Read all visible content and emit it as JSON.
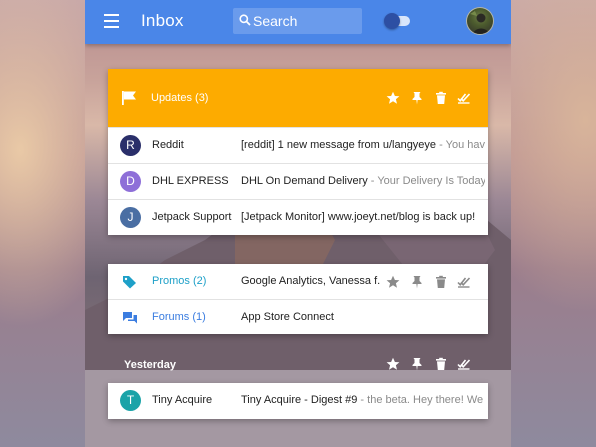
{
  "app": {
    "title": "Inbox",
    "accent_color": "#4a86e8"
  },
  "search": {
    "placeholder": "Search",
    "icon": "search-icon"
  },
  "bundle_updates": {
    "label": "Updates (3)",
    "color": "#fdab00",
    "icon": "flag-icon",
    "actions": [
      "star-icon",
      "pin-icon",
      "trash-icon",
      "done-all-icon"
    ]
  },
  "updates_rows": [
    {
      "letter": "R",
      "letter_color": "#2a2f6a",
      "sender": "Reddit",
      "subject": "[reddit] 1 new message from u/langyeye",
      "snippet": " - You hav"
    },
    {
      "letter": "D",
      "letter_color": "#8e6fd8",
      "sender": "DHL EXPRESS",
      "subject": "DHL On Demand Delivery",
      "snippet": " - Your Delivery Is Today"
    },
    {
      "letter": "J",
      "letter_color": "#4a6ea3",
      "sender": "Jetpack Support",
      "subject": "[Jetpack Monitor] www.joeyt.net/blog is back up!",
      "snippet": ""
    }
  ],
  "bundles": [
    {
      "label": "Promos (2)",
      "subject": "Google Analytics, Vanessa f...",
      "icon": "tag-icon",
      "color": "#1ea0c8"
    },
    {
      "label": "Forums (1)",
      "subject": "App Store Connect",
      "icon": "forum-icon",
      "color": "#3b7de0"
    }
  ],
  "yesterday": {
    "label": "Yesterday",
    "actions": [
      "star-icon",
      "pin-icon",
      "trash-icon",
      "done-all-icon"
    ],
    "rows": [
      {
        "letter": "T",
        "letter_color": "#1aa3a8",
        "sender": "Tiny Acquire",
        "subject": "Tiny Acquire - Digest #9",
        "snippet": " - the beta. Hey there! We"
      }
    ]
  }
}
